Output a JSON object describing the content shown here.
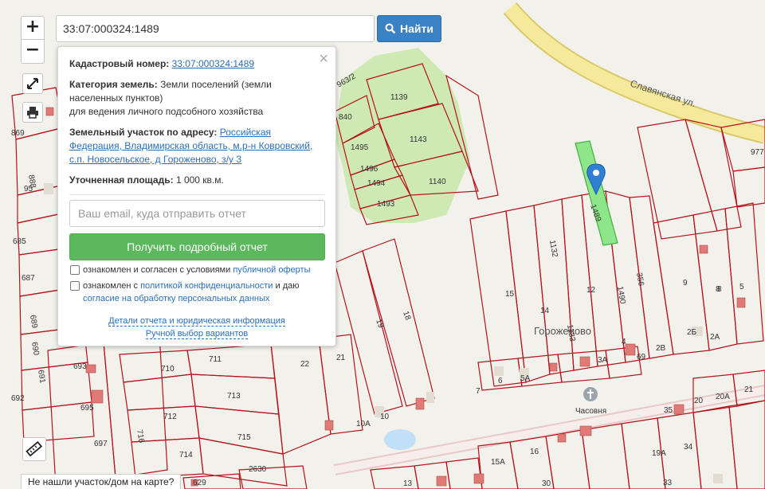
{
  "search": {
    "value": "33:07:000324:1489",
    "button_label": "Найти"
  },
  "zoom": {
    "in_label": "+",
    "out_label": "−"
  },
  "popup": {
    "cadastral_label": "Кадастровый номер:",
    "cadastral_value": "33:07:000324:1489",
    "category_label": "Категория земель:",
    "category_value": "Земли поселений (земли населенных пунктов)",
    "category_use": "для ведения личного подсобного хозяйства",
    "address_label": "Земельный участок по адресу:",
    "address_value": "Российская Федерация, Владимирская область, м.р-н Ковровский, с.п. Новосельское, д Гороженово, з/у 3",
    "area_label": "Уточненная площадь:",
    "area_value": "1 000 кв.м.",
    "email_placeholder": "Ваш email, куда отправить отчет",
    "report_button": "Получить подробный отчет",
    "consent1_text": "ознакомлен и согласен с условиями ",
    "consent1_link": "публичной оферты",
    "consent2_text": "ознакомлен с ",
    "consent2_link": "политикой конфиденциальности",
    "consent2_mid": " и даю ",
    "consent2_link2": "согласие на обработку персональных данных",
    "details_link": "Детали отчета и юридическая информация",
    "manual_link": "Ручной выбор вариантов"
  },
  "map": {
    "street": "Славянская ул.",
    "village": "Гороженово",
    "chapel": "Часовня",
    "colors": {
      "background": "#f3f1ec",
      "parcel_border": "#b5121b",
      "forest": "#cfe9b5",
      "road": "#f7e99c",
      "selected": "#8fe68a",
      "building": "#e07a76",
      "marker": "#2f7fd3"
    },
    "plot_labels": [
      "1139",
      "840",
      "1495",
      "1143",
      "1496",
      "1494",
      "1140",
      "1493",
      "1489",
      "1132",
      "1133",
      "1490",
      "356",
      "12",
      "15",
      "14",
      "9",
      "8",
      "5",
      "2Б",
      "2А",
      "2В",
      "4",
      "3А",
      "5А",
      "69",
      "977",
      "18",
      "19",
      "22",
      "21",
      "10А",
      "10",
      "7",
      "6",
      "693",
      "710",
      "711",
      "695",
      "713",
      "712",
      "697",
      "715",
      "714",
      "716",
      "2630",
      "629",
      "13",
      "30",
      "33",
      "34",
      "19А",
      "15А",
      "16",
      "20",
      "20А",
      "21",
      "35",
      "685",
      "687",
      "689",
      "690",
      "691",
      "692",
      "869",
      "888",
      "95",
      "963/2",
      "8"
    ]
  },
  "notfound": "Не нашли участок/дом на карте?"
}
